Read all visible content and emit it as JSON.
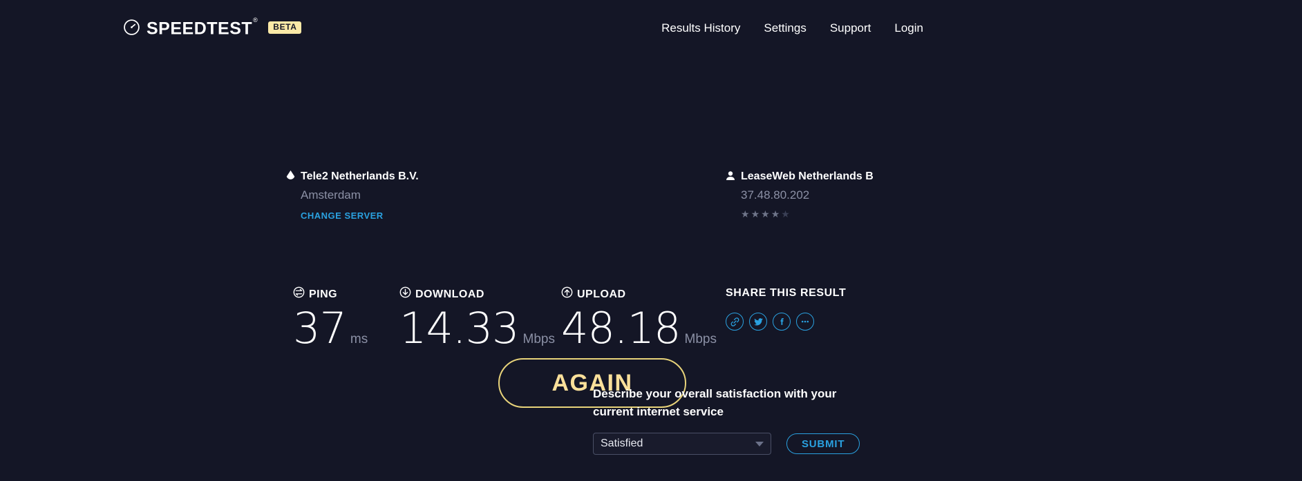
{
  "header": {
    "logo": {
      "icon": "speedometer-icon",
      "word": "SPEEDTEST",
      "registered": "®",
      "badge": "BETA",
      "badge_color": "#fbe9a7"
    },
    "nav": [
      {
        "label": "Results History"
      },
      {
        "label": "Settings"
      },
      {
        "label": "Support"
      },
      {
        "label": "Login"
      }
    ]
  },
  "result": {
    "server": {
      "icon": "server-drop-icon",
      "name": "Tele2 Netherlands B.V.",
      "city": "Amsterdam",
      "change_link": "CHANGE SERVER",
      "link_color": "#2aa1e0"
    },
    "again_button": {
      "label": "AGAIN",
      "color": "#fbe09a",
      "border_color": "#e8d37a"
    },
    "isp": {
      "icon": "person-icon",
      "name": "LeaseWeb Netherlands B",
      "ip": "37.48.80.202",
      "rating": 4,
      "rating_max": 5
    }
  },
  "metrics": [
    {
      "icon": "ping-icon",
      "label": "PING",
      "value": "37",
      "unit": "ms"
    },
    {
      "icon": "download-arrow-icon",
      "label": "DOWNLOAD",
      "value": "14.33",
      "unit": "Mbps"
    },
    {
      "icon": "upload-arrow-icon",
      "label": "UPLOAD",
      "value": "48.18",
      "unit": "Mbps"
    }
  ],
  "share": {
    "title": "SHARE THIS RESULT",
    "icons": [
      {
        "name": "link-icon"
      },
      {
        "name": "twitter-icon"
      },
      {
        "name": "facebook-icon"
      },
      {
        "name": "more-options-icon"
      }
    ],
    "accent_color": "#2aa1e0"
  },
  "survey": {
    "question": "Describe your overall satisfaction with your current internet service",
    "select_value": "Satisfied",
    "submit_label": "SUBMIT"
  },
  "theme": {
    "background": "#141626",
    "text": "#ffffff",
    "muted": "#8b90a5",
    "accent_blue": "#2aa1e0",
    "accent_yellow": "#fbe09a"
  }
}
